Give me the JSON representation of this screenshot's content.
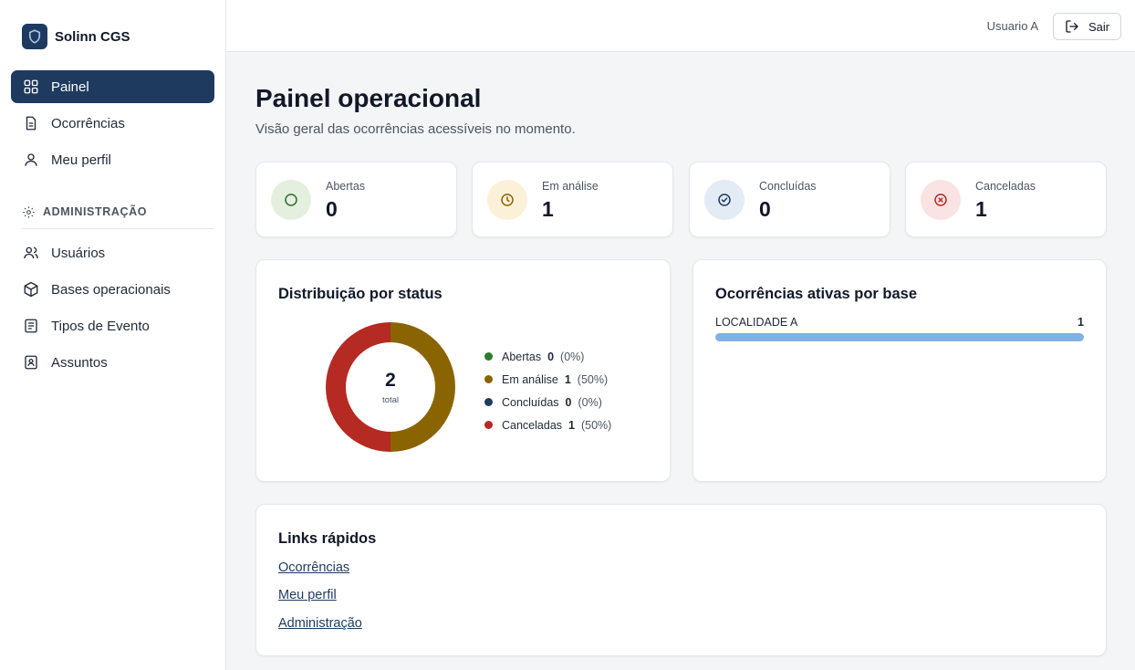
{
  "brand": {
    "name": "Solinn CGS"
  },
  "sidebar": {
    "items": [
      {
        "label": "Painel",
        "icon": "grid-icon",
        "active": true
      },
      {
        "label": "Ocorrências",
        "icon": "document-icon"
      },
      {
        "label": "Meu perfil",
        "icon": "user-icon"
      }
    ],
    "admin_section": {
      "label": "ADMINISTRAÇÃO",
      "icon": "gear-icon"
    },
    "admin_items": [
      {
        "label": "Usuários",
        "icon": "users-icon"
      },
      {
        "label": "Bases operacionais",
        "icon": "box-icon"
      },
      {
        "label": "Tipos de Evento",
        "icon": "list-icon"
      },
      {
        "label": "Assuntos",
        "icon": "badge-icon"
      }
    ]
  },
  "topbar": {
    "user": "Usuario A",
    "logout_label": "Sair"
  },
  "page": {
    "title": "Painel operacional",
    "subtitle": "Visão geral das ocorrências acessíveis no momento."
  },
  "stats": [
    {
      "label": "Abertas",
      "value": "0",
      "icon": "circle-icon",
      "color": "#2f6b2f",
      "bg": "#e4efe0"
    },
    {
      "label": "Em análise",
      "value": "1",
      "icon": "clock-icon",
      "color": "#8a6400",
      "bg": "#fbf1d9"
    },
    {
      "label": "Concluídas",
      "value": "0",
      "icon": "check-circle-icon",
      "color": "#1e3a5f",
      "bg": "#e3ebf5"
    },
    {
      "label": "Canceladas",
      "value": "1",
      "icon": "x-circle-icon",
      "color": "#b52a22",
      "bg": "#f9e4e3"
    }
  ],
  "distribution": {
    "title": "Distribuição por status",
    "total": "2",
    "total_label": "total",
    "legend": [
      {
        "label": "Abertas",
        "count": "0",
        "pct": "(0%)",
        "color": "#2f7a2f"
      },
      {
        "label": "Em análise",
        "count": "1",
        "pct": "(50%)",
        "color": "#8a6400"
      },
      {
        "label": "Concluídas",
        "count": "0",
        "pct": "(0%)",
        "color": "#1e3a5f"
      },
      {
        "label": "Canceladas",
        "count": "1",
        "pct": "(50%)",
        "color": "#b52a22"
      }
    ]
  },
  "chart_data": {
    "type": "pie",
    "categories": [
      "Abertas",
      "Em análise",
      "Concluídas",
      "Canceladas"
    ],
    "values": [
      0,
      1,
      0,
      1
    ],
    "colors": [
      "#2f7a2f",
      "#8a6400",
      "#1e3a5f",
      "#b52a22"
    ],
    "title": "Distribuição por status",
    "legend_position": "right"
  },
  "by_base": {
    "title": "Ocorrências ativas por base",
    "rows": [
      {
        "name": "LOCALIDADE A",
        "count": "1",
        "fill": 1.0
      }
    ]
  },
  "quick_links": {
    "title": "Links rápidos",
    "items": [
      "Ocorrências",
      "Meu perfil",
      "Administração"
    ]
  }
}
